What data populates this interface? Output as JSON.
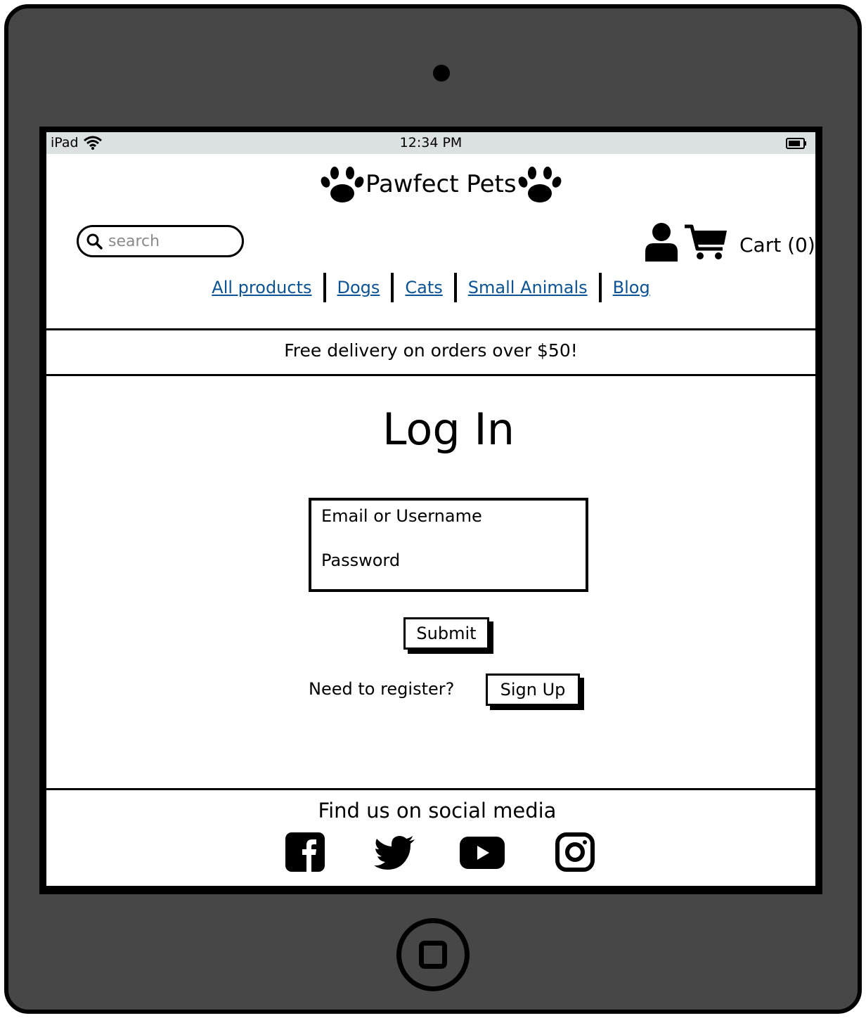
{
  "status_bar": {
    "device": "iPad",
    "time": "12:34 PM"
  },
  "header": {
    "logo_text": "Pawfect Pets",
    "search_placeholder": "search",
    "cart_label": "Cart (0)"
  },
  "nav": {
    "items": [
      {
        "label": "All products"
      },
      {
        "label": "Dogs"
      },
      {
        "label": "Cats"
      },
      {
        "label": "Small Animals"
      },
      {
        "label": "Blog"
      }
    ]
  },
  "banner": {
    "text": "Free delivery on orders over $50!"
  },
  "login": {
    "title": "Log In",
    "email_label": "Email or Username",
    "password_label": "Password",
    "submit_label": "Submit",
    "register_prompt": "Need to register?",
    "signup_label": "Sign Up"
  },
  "footer": {
    "title": "Find us on social media",
    "icons": [
      "facebook-icon",
      "twitter-icon",
      "youtube-icon",
      "instagram-icon"
    ]
  },
  "colors": {
    "device_body": "#474747",
    "status_bar": "#dbe1e3",
    "link": "#0b5394",
    "placeholder": "#8a8a8a"
  }
}
